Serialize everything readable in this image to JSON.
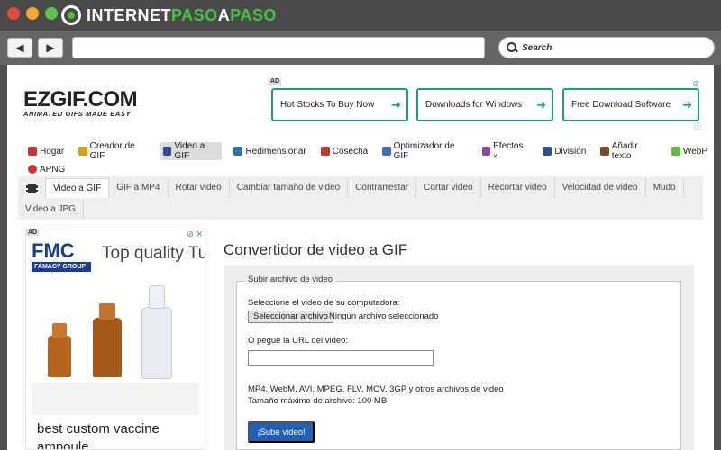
{
  "browser": {
    "brand_left": "INTERNET",
    "brand_mid": "PASO",
    "brand_a": "A",
    "brand_right": "PASO",
    "search_placeholder": "Search",
    "back_icon": "◀",
    "forward_icon": "▶"
  },
  "site": {
    "logo_main": "EZGIF.COM",
    "logo_sub": "ANIMATED GIFS MADE EASY"
  },
  "top_ad": {
    "tag": "AD",
    "buttons": [
      "Hot Stocks To Buy Now",
      "Downloads for Windows",
      "Free Download Software"
    ]
  },
  "main_menu": [
    {
      "label": "Hogar",
      "icon": "home-icon",
      "color": "#c0392b"
    },
    {
      "label": "Creador de GIF",
      "icon": "maker-icon",
      "color": "#d4a017"
    },
    {
      "label": "Video a GIF",
      "icon": "video-icon",
      "color": "#2e4d8a",
      "active": true
    },
    {
      "label": "Redimensionar",
      "icon": "resize-icon",
      "color": "#2e6fb5"
    },
    {
      "label": "Cosecha",
      "icon": "crop-icon",
      "color": "#c0392b"
    },
    {
      "label": "Optimizador de GIF",
      "icon": "optimize-icon",
      "color": "#3a6fb0"
    },
    {
      "label": "Efectos »",
      "icon": "effects-icon",
      "color": "#8e44ad"
    },
    {
      "label": "División",
      "icon": "split-icon",
      "color": "#2e4d8a"
    },
    {
      "label": "Añadir texto",
      "icon": "text-icon",
      "color": "#7a4a2a"
    },
    {
      "label": "WebP",
      "icon": "webp-icon",
      "color": "#5fbf3a"
    },
    {
      "label": "APNG",
      "icon": "apng-icon",
      "color": "#d9302c"
    }
  ],
  "sub_tabs": [
    "Video a GIF",
    "GIF a MP4",
    "Rotar video",
    "Cambiar tamaño de video",
    "Contrarrestar",
    "Cortar video",
    "Recortar video",
    "Velocidad de video",
    "Mudo",
    "Video a JPG"
  ],
  "left_ad": {
    "tag": "AD",
    "brand": "FMC",
    "brand_band": "FAMACY GROUP",
    "headline": "Top quality Tu",
    "caption": "best custom vaccine ampoule"
  },
  "converter": {
    "title": "Convertidor de video a GIF",
    "legend": "Subir archivo de video",
    "select_label": "Seleccione el video de su computadora:",
    "file_button": "Seleccionar archivo",
    "file_status": "Ningún archivo seleccionado",
    "url_label": "O pegue la URL del video:",
    "formats": "MP4, WebM, AVI, MPEG, FLV, MOV, 3GP y otros archivos de video",
    "max_size": "Tamaño máximo de archivo: 100 MB",
    "upload_button": "¡Sube video!"
  },
  "colors": {
    "accent_green": "#1aa36e",
    "upload_blue": "#2260b8",
    "brand_green": "#43c43f"
  }
}
